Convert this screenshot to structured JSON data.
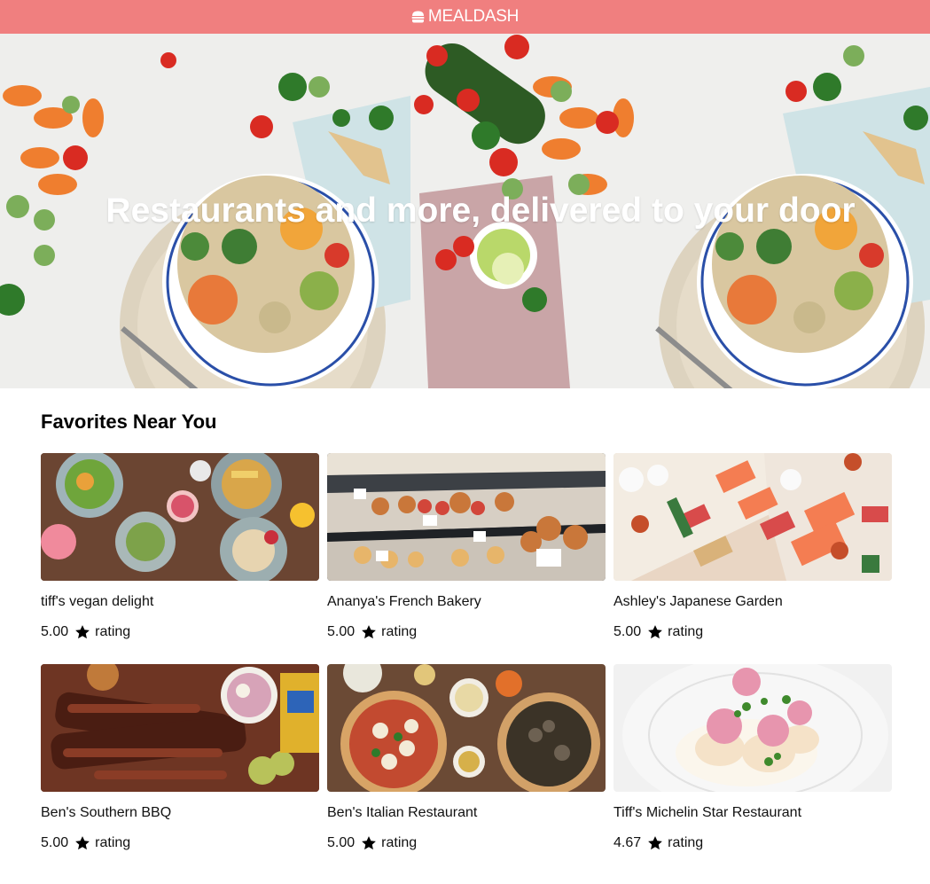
{
  "header": {
    "brand": "MEALDASH",
    "logo_icon": "burger-icon",
    "background": "#f07f7f"
  },
  "hero": {
    "title": "Restaurants and more, delivered to your door"
  },
  "section": {
    "title": "Favorites Near You"
  },
  "restaurants": [
    {
      "name": "tiff's vegan delight",
      "rating": "5.00",
      "rating_label": "rating",
      "image": "vegan-dishes-photo"
    },
    {
      "name": "Ananya's French Bakery",
      "rating": "5.00",
      "rating_label": "rating",
      "image": "pastry-case-photo"
    },
    {
      "name": "Ashley's Japanese Garden",
      "rating": "5.00",
      "rating_label": "rating",
      "image": "sushi-box-photo"
    },
    {
      "name": "Ben's Southern BBQ",
      "rating": "5.00",
      "rating_label": "rating",
      "image": "bbq-ribs-photo"
    },
    {
      "name": "Ben's Italian Restaurant",
      "rating": "5.00",
      "rating_label": "rating",
      "image": "pizza-table-photo"
    },
    {
      "name": "Tiff's Michelin Star Restaurant",
      "rating": "4.67",
      "rating_label": "rating",
      "image": "fine-dining-plate-photo"
    }
  ]
}
